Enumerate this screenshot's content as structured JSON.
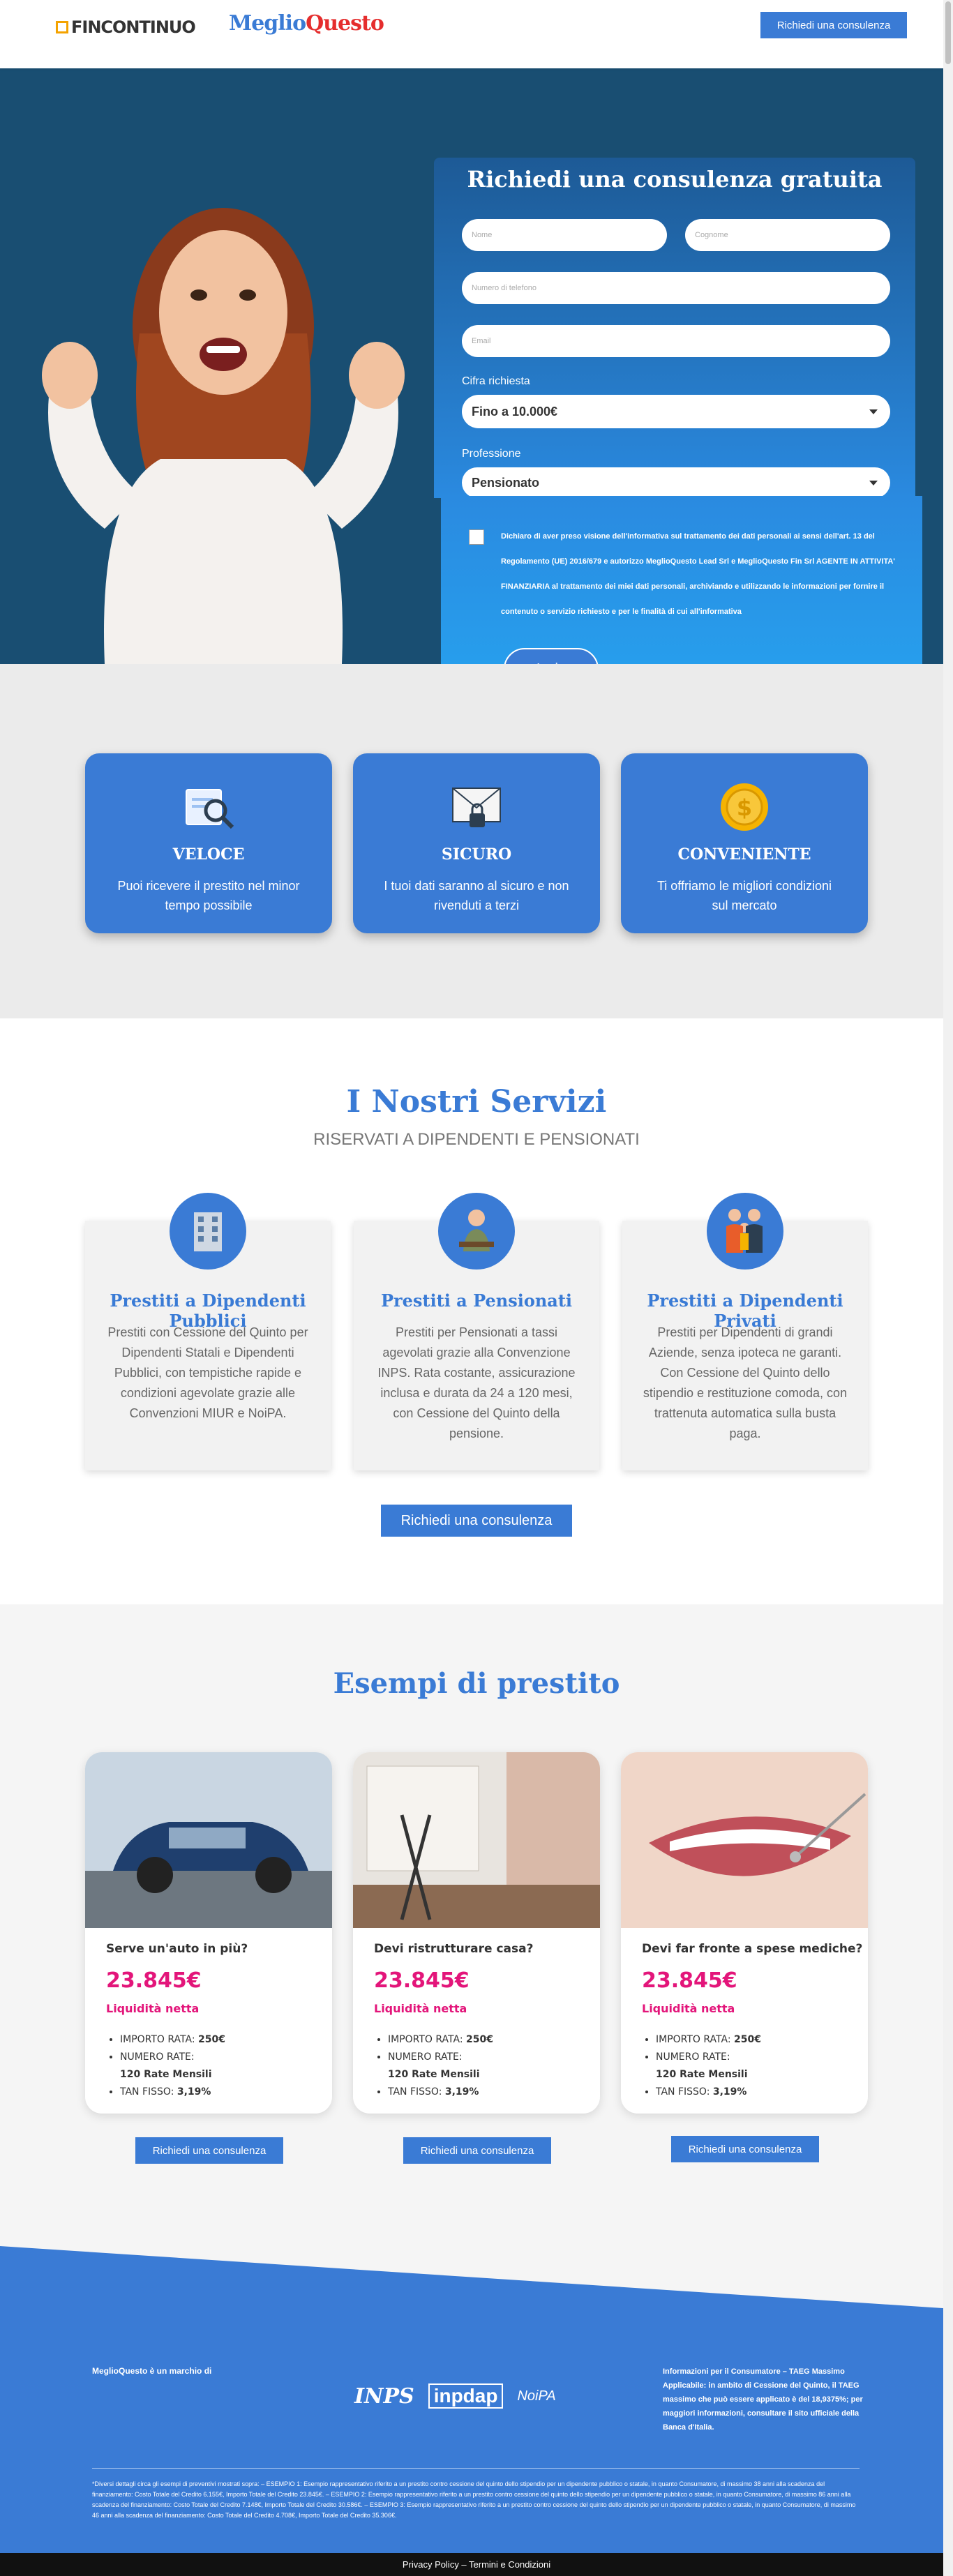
{
  "header": {
    "logo_fincontinuo": "FINCONTINUO",
    "logo_megliq": "Meglio",
    "logo_questo": "Questo",
    "cta": "Richiedi una consulenza"
  },
  "form": {
    "title": "Richiedi una consulenza gratuita",
    "name_placeholder": "Nome",
    "surname_placeholder": "Cognome",
    "phone_placeholder": "Numero di telefono",
    "email_placeholder": "Email",
    "amount_label": "Cifra richiesta",
    "amount_value": "Fino a 10.000€",
    "profession_label": "Professione",
    "profession_value": "Pensionato",
    "consent": "Dichiaro di aver preso visione dell'informativa sul trattamento dei dati personali ai sensi dell'art. 13 del Regolamento (UE) 2016/679 e autorizzo MeglioQuesto Lead Srl e MeglioQuesto Fin Srl AGENTE IN ATTIVITA' FINANZIARIA al trattamento dei miei dati personali, archiviando e utilizzando le informazioni per fornire il contenuto o servizio richiesto e per le finalità di cui all'informativa",
    "submit": "Invia"
  },
  "features": [
    {
      "icon": "magnifier-document-icon",
      "title": "VELOCE",
      "desc": "Puoi ricevere il prestito nel minor tempo possibile"
    },
    {
      "icon": "secure-envelope-icon",
      "title": "SICURO",
      "desc": "I tuoi dati saranno al sicuro e non rivenduti a terzi"
    },
    {
      "icon": "coin-icon",
      "title": "CONVENIENTE",
      "desc": "Ti offriamo le migliori condizioni sul mercato"
    }
  ],
  "services": {
    "title": "I Nostri Servizi",
    "subtitle": "RISERVATI A DIPENDENTI E PENSIONATI",
    "cards": [
      {
        "icon": "building-icon",
        "title": "Prestiti a Dipendenti Pubblici",
        "desc": "Prestiti con Cessione del Quinto per Dipendenti Statali e Dipendenti Pubblici, con tempistiche rapide e condizioni agevolate grazie alle Convenzioni MIUR e NoiPA."
      },
      {
        "icon": "pensioner-icon",
        "title": "Prestiti a Pensionati",
        "desc": "Prestiti per Pensionati a tassi agevolati grazie alla Convenzione INPS. Rata costante, assicurazione inclusa e durata da 24 a 120 mesi, con Cessione del Quinto della pensione."
      },
      {
        "icon": "family-icon",
        "title": "Prestiti a Dipendenti Privati",
        "desc": "Prestiti per Dipendenti di grandi Aziende, senza ipoteca ne garanti. Con Cessione del Quinto dello stipendio e restituzione comoda, con trattenuta automatica sulla busta paga."
      }
    ],
    "cta": "Richiedi una consulenza"
  },
  "loans": {
    "title": "Esempi di prestito",
    "cards": [
      {
        "question": "Serve un'auto in più?",
        "amount": "23.845€",
        "label": "Liquidità netta",
        "rata_label": "IMPORTO RATA:",
        "rata": "250€",
        "numero_label": "NUMERO RATE:",
        "numero": "120 Rate Mensili",
        "tan_label": "TAN FISSO:",
        "tan": "3,19%",
        "cta": "Richiedi una consulenza"
      },
      {
        "question": "Devi ristrutturare casa?",
        "amount": "23.845€",
        "label": "Liquidità netta",
        "rata_label": "IMPORTO RATA:",
        "rata": "250€",
        "numero_label": "NUMERO RATE:",
        "numero": "120 Rate Mensili",
        "tan_label": "TAN FISSO:",
        "tan": "3,19%",
        "cta": "Richiedi una consulenza"
      },
      {
        "question": "Devi far fronte a spese mediche?",
        "amount": "23.845€",
        "label": "Liquidità netta",
        "rata_label": "IMPORTO RATA:",
        "rata": "250€",
        "numero_label": "NUMERO RATE:",
        "numero": "120 Rate Mensili",
        "tan_label": "TAN FISSO:",
        "tan": "3,19%",
        "cta": "Richiedi una consulenza"
      }
    ]
  },
  "footer": {
    "brand_mark": "MeglioQuesto è un marchio di",
    "logo_inps": "INPS",
    "logo_inpdap": "inpdap",
    "logo_noipa": "NoiPA",
    "info": "Informazioni per il Consumatore – TAEG Massimo Applicabile: in ambito di Cessione del Quinto, il TAEG massimo che può essere applicato è del 18,9375%; per maggiori informazioni, consultare il sito ufficiale della Banca d'Italia.",
    "fine_print": "*Diversi dettagli circa gli esempi di preventivi mostrati sopra: – ESEMPIO 1: Esempio rappresentativo riferito a un prestito contro cessione del quinto dello stipendio per un dipendente pubblico o statale, in quanto Consumatore, di massimo 38 anni alla scadenza del finanziamento: Costo Totale del Credito 6.155€, Importo Totale del Credito 23.845€. – ESEMPIO 2: Esempio rappresentativo riferito a un prestito contro cessione del quinto dello stipendio per un dipendente pubblico o statale, in quanto Consumatore, di massimo 86 anni alla scadenza del finanziamento: Costo Totale del Credito 7.148€, Importo Totale del Credito 30.586€. – ESEMPIO 3: Esempio rappresentativo riferito a un prestito contro cessione del quinto dello stipendio per un dipendente pubblico o statale, in quanto Consumatore, di massimo 46 anni alla scadenza del finanziamento: Costo Totale del Credito 4.708€, Importo Totale del Credito 35.306€.",
    "bottom": "Privacy Policy – Termini e Condizioni"
  },
  "colors": {
    "brand": "#3a7bd5",
    "hero_bg": "#194e72",
    "accent_pink": "#e3157a"
  }
}
